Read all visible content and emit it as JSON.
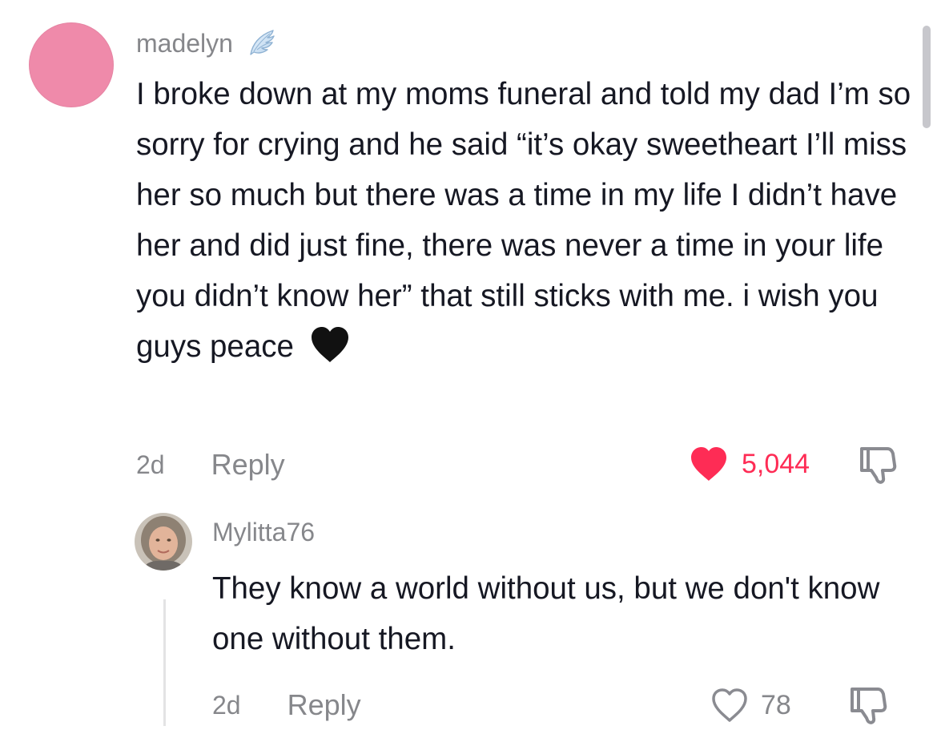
{
  "comment": {
    "username": "madelyn",
    "badge_icon": "angel-wing-icon",
    "avatar_color": "#ef8aaa",
    "text": "I broke down at my moms funeral and told my dad I’m so sorry for crying and he said “it’s okay sweetheart I’ll miss her so much but there was a time in my life I didn’t have her and did just fine, there was never a time in your life you didn’t know her” that still sticks with me. i wish you guys peace",
    "emoji": "black-heart-icon",
    "time": "2d",
    "reply_label": "Reply",
    "likes": "5,044",
    "liked": true,
    "like_color": "#fe2c55"
  },
  "reply": {
    "username": "Mylitta76",
    "text": "They know a world without us, but we don't know one without them.",
    "time": "2d",
    "reply_label": "Reply",
    "likes": "78",
    "liked": false
  },
  "colors": {
    "secondary_text": "#86878b",
    "primary_text": "#161823"
  }
}
